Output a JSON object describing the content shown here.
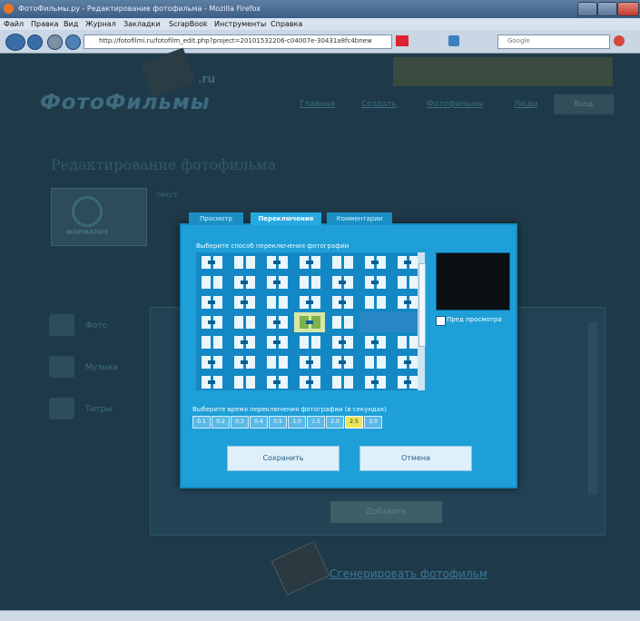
{
  "browser": {
    "window_title": "ФотоФильмы.ру - Редактирование фотофильма - Mozilla Firefox",
    "menu": [
      "Файл",
      "Правка",
      "Вид",
      "Журнал",
      "Закладки",
      "ScrapBook",
      "Инструменты",
      "Справка"
    ],
    "url": "http://fotofilmi.ru/fotofilm_edit.php?project=20101532206-c04007e-30431a8fc4bnew",
    "search_placeholder": "Google"
  },
  "site": {
    "logo": "ФотоФильмы",
    "logo_badge": ".ru",
    "nav": [
      "Главная",
      "Создать",
      "Фотофильмы",
      "Люди"
    ],
    "login_label": "Вход",
    "page_title": "Редактирование фотофильма",
    "project_thumb_label": "ФОРМАТИЗ",
    "project_text": "текст",
    "left_menu": [
      "Фото",
      "Музыка",
      "Титры"
    ],
    "add_button": "Добавить",
    "generate_link": "Сгенерировать фотофильм"
  },
  "modal": {
    "tabs": [
      "Просмотр",
      "Переключение",
      "Комментарии"
    ],
    "active_tab": 1,
    "select_prompt": "Выберите способ переключения фотографии",
    "preview_checkbox_label": "Пред просмотра",
    "time_prompt": "Выберите время переключения фотографии (в секундах)",
    "durations": [
      "0.1",
      "0.2",
      "0.3",
      "0.4",
      "0.5",
      "1.0",
      "1.5",
      "2.0",
      "2.5",
      "3.0"
    ],
    "selected_duration": "2.5",
    "save_button": "Сохранить",
    "cancel_button": "Отмена"
  },
  "colors": {
    "background": "#1e3a49",
    "modal": "#1f9fd8",
    "selected_transition": "#d7e7a8",
    "selected_duration": "#e9e65a"
  }
}
